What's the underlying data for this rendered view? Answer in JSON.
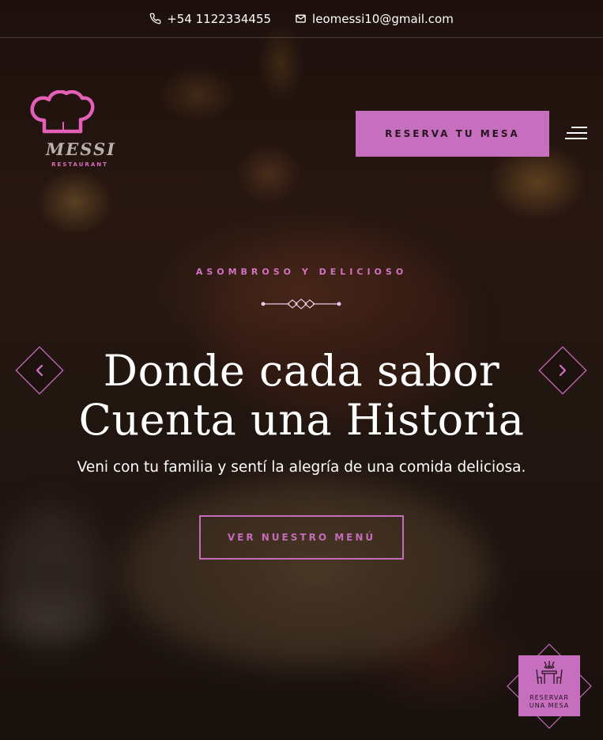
{
  "topbar": {
    "phone": "+54 1122334455",
    "email": "leomessi10@gmail.com"
  },
  "logo": {
    "name": "MESSI",
    "subtitle": "RESTAURANT"
  },
  "header": {
    "reserve_label": "RESERVA TU MESA"
  },
  "hero": {
    "eyebrow": "ASOMBROSO Y DELICIOSO",
    "title_line1": "Donde cada sabor",
    "title_line2": "Cuenta una Historia",
    "subtitle": "Veni con tu familia y sentí la alegría de una comida deliciosa.",
    "menu_button": "VER NUESTRO MENÚ"
  },
  "floating": {
    "label_line1": "RESERVAR",
    "label_line2": "UNA MESA"
  },
  "colors": {
    "accent": "#c56fbe",
    "accent_text": "#d173c2",
    "logo_pink": "#e35fb8"
  },
  "icons": {
    "phone": "phone-icon",
    "email": "mail-icon",
    "logo": "chef-hat-icon",
    "menu": "hamburger-icon",
    "prev": "chevron-left-icon",
    "next": "chevron-right-icon",
    "table": "dining-table-icon"
  }
}
